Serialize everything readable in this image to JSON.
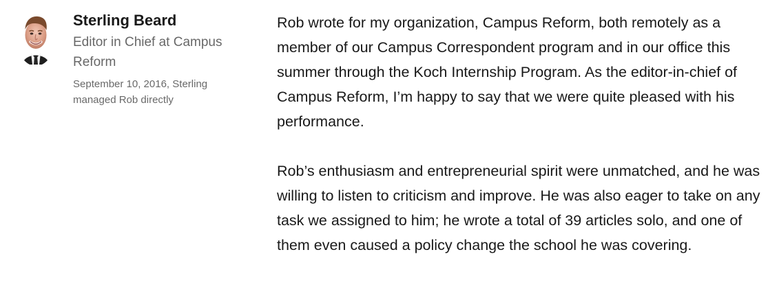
{
  "recommender": {
    "name": "Sterling Beard",
    "headline": "Editor in Chief at Campus Reform",
    "meta": "September 10, 2016, Sterling managed Rob directly",
    "avatar_icon": "profile-photo-icon"
  },
  "recommendation": {
    "paragraphs": [
      "Rob wrote for my organization, Campus Reform, both remotely as a member of our Campus Correspondent program and in our office this summer through the Koch Internship Program. As the editor-in-chief of Campus Reform, I’m happy to say that we were quite pleased with his performance.",
      "Rob’s enthusiasm and entrepreneurial spirit were unmatched, and he was willing to listen to criticism and improve. He was also eager to take on any task we assigned to him; he wrote a total of 39 articles solo, and one of them even caused a policy change the school he was covering."
    ]
  },
  "colors": {
    "primary_text": "#191919",
    "secondary_text": "#666666",
    "background": "#ffffff"
  }
}
